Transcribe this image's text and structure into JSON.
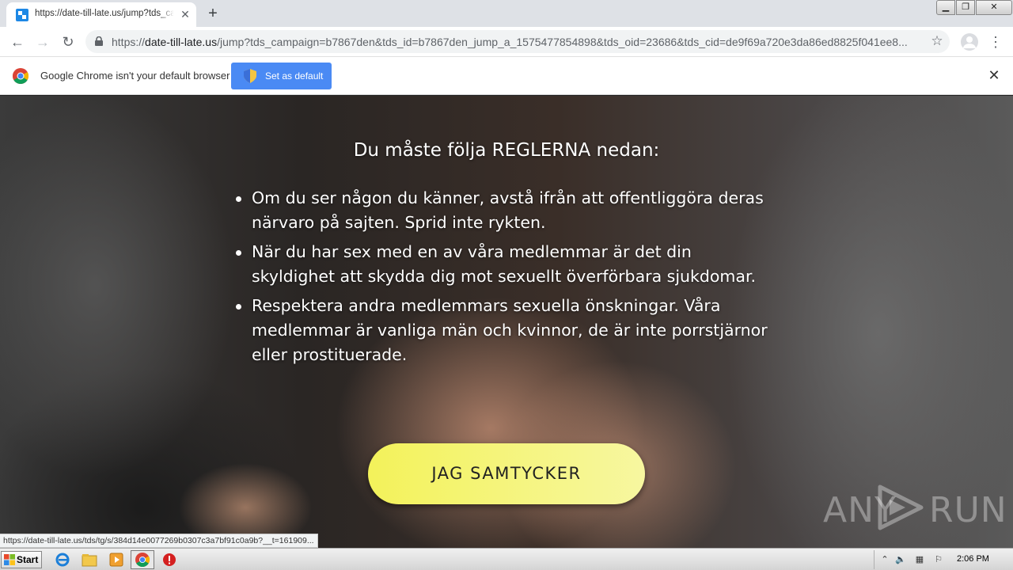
{
  "browser": {
    "tab_title": "https://date-till-late.us/jump?tds_campaign=b7867den",
    "new_tab_symbol": "+",
    "url_scheme": "https://",
    "url_host": "date-till-late.us",
    "url_rest": "/jump?tds_campaign=b7867den&tds_id=b7867den_jump_a_1575477854898&tds_oid=23686&tds_cid=de9f69a720e3da86ed8825f041ee8...",
    "infobar_message": "Google Chrome isn't your default browser",
    "set_default_label": "Set as default"
  },
  "page": {
    "title": "Du måste följa REGLERNA nedan:",
    "rules": [
      "Om du ser någon du känner, avstå ifrån att offentliggöra deras närvaro på sajten. Sprid inte rykten.",
      "När du har sex med en av våra medlemmar är det din skyldighet att skydda dig mot sexuellt överförbara sjukdomar.",
      "Respektera andra medlemmars sexuella önskningar. Våra medlemmar är vanliga män och kvinnor, de är inte porrstjärnor eller prostituerade."
    ],
    "agree_button": "JAG SAMTYCKER",
    "watermark_left": "ANY",
    "watermark_right": "RUN",
    "status_url": "https://date-till-late.us/tds/tg/s/384d14e0077269b0307c3a7bf91c0a9b?__t=161909..."
  },
  "taskbar": {
    "start_label": "Start",
    "clock": "2:06 PM"
  },
  "colors": {
    "accent_blue": "#4a8af4",
    "button_yellow": "#f3f25a"
  }
}
